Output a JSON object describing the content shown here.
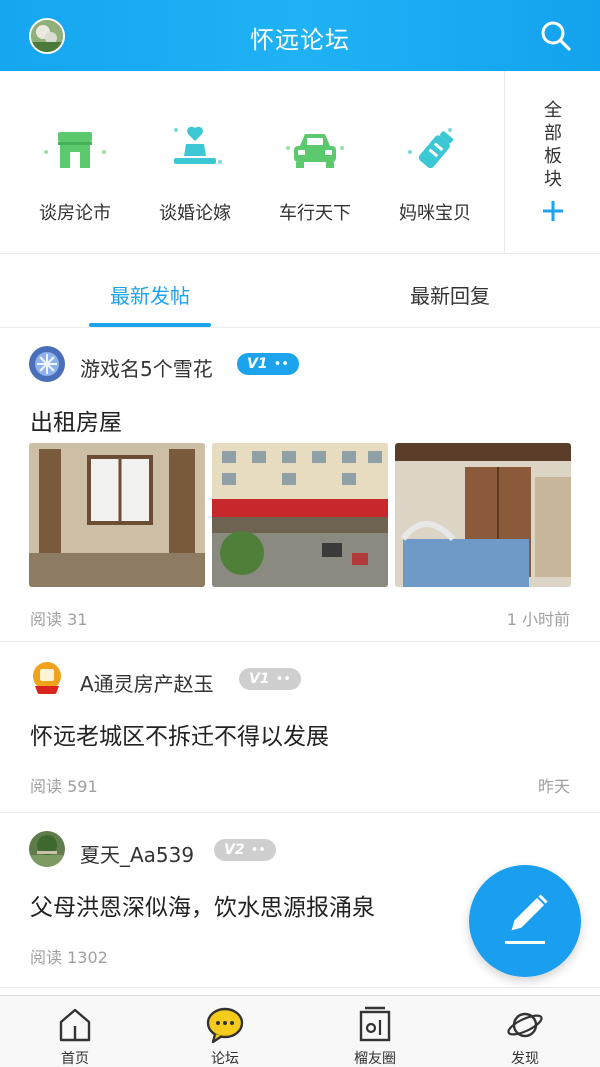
{
  "header": {
    "title": "怀远论坛",
    "avatar_icon": "user-avatar",
    "search_icon": "search-icon"
  },
  "categories": [
    {
      "label": "谈房论市",
      "icon": "shop-icon"
    },
    {
      "label": "谈婚论嫁",
      "icon": "ring-icon"
    },
    {
      "label": "车行天下",
      "icon": "car-icon"
    },
    {
      "label": "妈咪宝贝",
      "icon": "baby-bottle-icon"
    }
  ],
  "all_boards": {
    "label": "全部板块",
    "icon": "plus-icon"
  },
  "tabs": [
    {
      "label": "最新发帖",
      "active": true
    },
    {
      "label": "最新回复",
      "active": false
    }
  ],
  "posts": [
    {
      "author": "游戏名5个雪花",
      "level": "V1",
      "level_color": "#1ba3ec",
      "title": "出租房屋",
      "read": "阅读 31",
      "time": "1 小时前",
      "images": [
        "room-window-photo",
        "street-shops-photo",
        "bedroom-photo"
      ]
    },
    {
      "author": "A通灵房产赵玉",
      "level": "V1",
      "level_color": "#cfcfcf",
      "title": "怀远老城区不拆迁不得以发展",
      "read": "阅读 591",
      "time": "昨天"
    },
    {
      "author": "夏天_Aa539",
      "level": "V2",
      "level_color": "#cfcfcf",
      "title": "父母洪恩深似海，饮水思源报涌泉",
      "read": "阅读 1302",
      "time": ""
    }
  ],
  "badge_dots": "••",
  "fab": {
    "icon": "edit-pencil-icon"
  },
  "bottom_nav": [
    {
      "label": "首页",
      "icon": "home-icon"
    },
    {
      "label": "论坛",
      "icon": "forum-chat-icon"
    },
    {
      "label": "榴友圈",
      "icon": "circle-frame-icon"
    },
    {
      "label": "发现",
      "icon": "planet-icon"
    }
  ],
  "colors": {
    "primary": "#1ba3ec",
    "category_green": "#5cc96f",
    "text": "#333333",
    "muted": "#a0a0a0"
  }
}
